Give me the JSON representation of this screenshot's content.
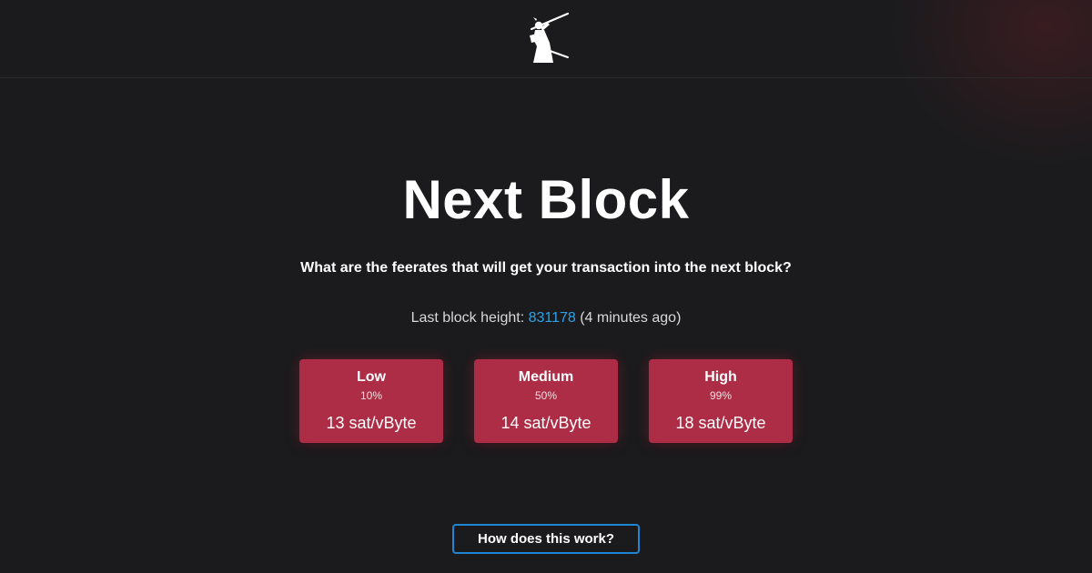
{
  "header": {
    "logo_icon": "samurai-logo-icon"
  },
  "main": {
    "title": "Next Block",
    "subtitle": "What are the feerates that will get your transaction into the next block?",
    "last_block": {
      "prefix": "Last block height: ",
      "height": "831178",
      "suffix": " (4 minutes ago)"
    },
    "fee_cards": [
      {
        "label": "Low",
        "percent": "10%",
        "rate": "13 sat/vByte"
      },
      {
        "label": "Medium",
        "percent": "50%",
        "rate": "14 sat/vByte"
      },
      {
        "label": "High",
        "percent": "99%",
        "rate": "18 sat/vByte"
      }
    ],
    "help_button_label": "How does this work?"
  },
  "colors": {
    "background": "#1b1b1d",
    "card": "#ac2d45",
    "link": "#2aa3ea",
    "button_border": "#1f86d3"
  }
}
